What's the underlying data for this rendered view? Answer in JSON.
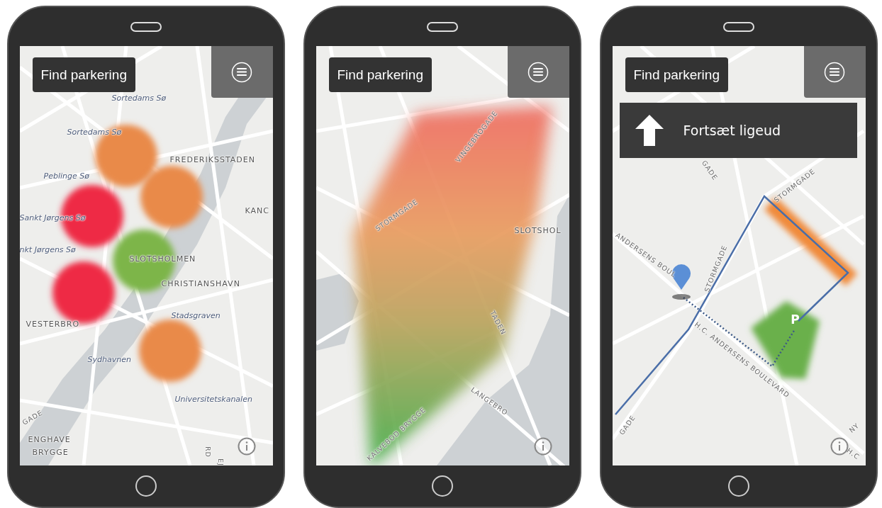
{
  "phones": [
    {
      "kind": "zones",
      "find_button": {
        "label": "Find parkering"
      },
      "map_labels": [
        {
          "text": "Sortedams Sø",
          "kind": "water"
        },
        {
          "text": "Sortedams Sø",
          "kind": "water"
        },
        {
          "text": "FREDERIKSSTADEN",
          "kind": "district"
        },
        {
          "text": "Peblinge Sø",
          "kind": "water"
        },
        {
          "text": "KANC",
          "kind": "district"
        },
        {
          "text": "Sankt Jørgens Sø",
          "kind": "water"
        },
        {
          "text": "SLOTSHOLMEN",
          "kind": "district"
        },
        {
          "text": "nkt Jørgens Sø",
          "kind": "water"
        },
        {
          "text": "CHRISTIANSHAVN",
          "kind": "district"
        },
        {
          "text": "VESTERBRO",
          "kind": "district"
        },
        {
          "text": "Stadsgraven",
          "kind": "water"
        },
        {
          "text": "Sydhavnen",
          "kind": "water"
        },
        {
          "text": "Universitetskanalen",
          "kind": "water"
        },
        {
          "text": "GADE",
          "kind": "street"
        },
        {
          "text": "ENGHAVE",
          "kind": "district"
        },
        {
          "text": "BRYGGE",
          "kind": "district"
        },
        {
          "text": "RD",
          "kind": "street"
        },
        {
          "text": "EJ",
          "kind": "street"
        }
      ],
      "zones": [
        {
          "color": "#e98a4a"
        },
        {
          "color": "#e98a4a"
        },
        {
          "color": "#ee2b44"
        },
        {
          "color": "#7db54a"
        },
        {
          "color": "#ee2b44"
        },
        {
          "color": "#e98a4a"
        }
      ]
    },
    {
      "kind": "heatmap",
      "find_button": {
        "label": "Find parkering"
      },
      "map_labels": [
        {
          "text": "VINGEBROGADE",
          "kind": "street"
        },
        {
          "text": "STORMGADE",
          "kind": "street"
        },
        {
          "text": "SLOTSHOL",
          "kind": "district"
        },
        {
          "text": "TADEN",
          "kind": "street"
        },
        {
          "text": "LANGEBRO",
          "kind": "street"
        },
        {
          "text": "KALVEBOD BRYGGE",
          "kind": "street"
        }
      ]
    },
    {
      "kind": "route",
      "find_button": {
        "label": "Find parkering"
      },
      "direction": {
        "text": "Fortsæt ligeud"
      },
      "map_labels": [
        {
          "text": "GADE",
          "kind": "street"
        },
        {
          "text": "STORMGADE",
          "kind": "street"
        },
        {
          "text": "ANDERSENS BOUL",
          "kind": "street"
        },
        {
          "text": "STORMGADE",
          "kind": "street"
        },
        {
          "text": "H.C. ANDERSENS BOULEVARD",
          "kind": "street"
        },
        {
          "text": "GADE",
          "kind": "street"
        },
        {
          "text": "NY",
          "kind": "street"
        },
        {
          "text": "H.C",
          "kind": "street"
        }
      ],
      "parking_pin": {
        "label": "P"
      }
    }
  ]
}
